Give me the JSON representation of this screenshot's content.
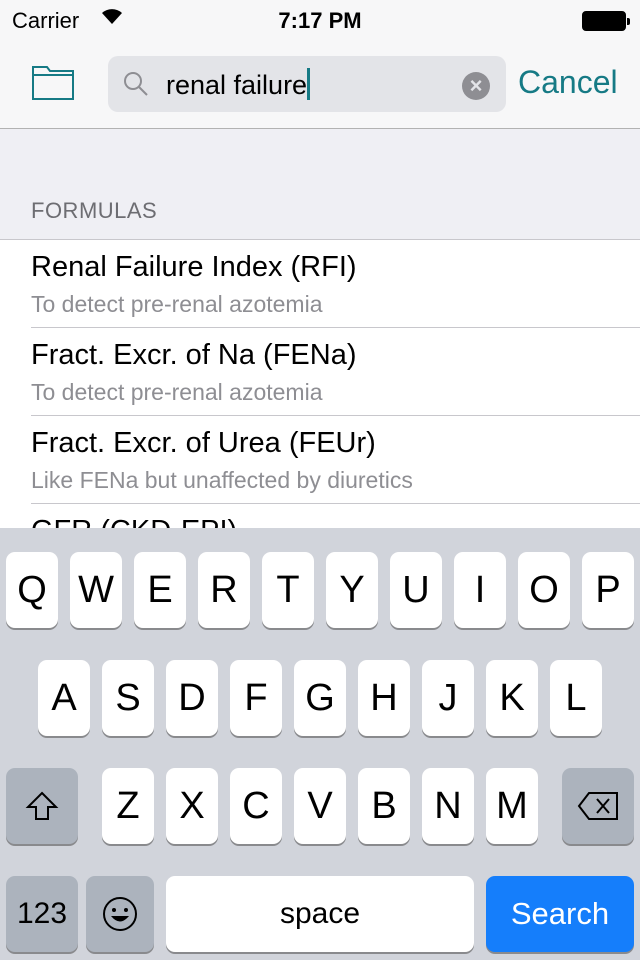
{
  "status": {
    "carrier": "Carrier",
    "time": "7:17 PM"
  },
  "nav": {
    "search_value": "renal failure",
    "cancel": "Cancel",
    "folder_icon": "folder-icon",
    "accent": "#167a85"
  },
  "section": "FORMULAS",
  "results": [
    {
      "title": "Renal Failure Index (RFI)",
      "subtitle": "To detect pre-renal azotemia"
    },
    {
      "title": "Fract. Excr. of Na (FENa)",
      "subtitle": "To detect pre-renal azotemia"
    },
    {
      "title": "Fract. Excr. of Urea (FEUr)",
      "subtitle": "Like FENa but unaffected by diuretics"
    },
    {
      "title": "GFR (CKD-EPI)",
      "subtitle": ""
    }
  ],
  "keyboard": {
    "row1": [
      "Q",
      "W",
      "E",
      "R",
      "T",
      "Y",
      "U",
      "I",
      "O",
      "P"
    ],
    "row2": [
      "A",
      "S",
      "D",
      "F",
      "G",
      "H",
      "J",
      "K",
      "L"
    ],
    "row3": [
      "Z",
      "X",
      "C",
      "V",
      "B",
      "N",
      "M"
    ],
    "numbers": "123",
    "space": "space",
    "search": "Search",
    "search_color": "#157efb"
  }
}
